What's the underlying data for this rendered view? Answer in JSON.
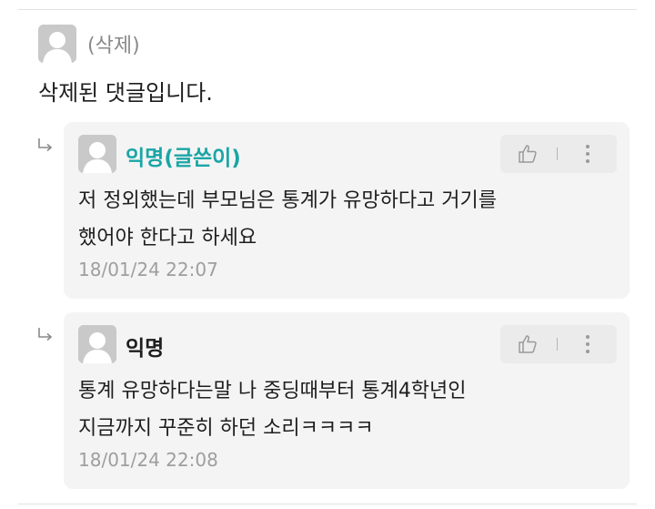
{
  "root_comment": {
    "author": "(삭제)",
    "body": "삭제된 댓글입니다."
  },
  "replies": [
    {
      "author": "익명(글쓴이)",
      "lines": [
        "저 정외했는데 부모님은 통계가 유망하다고 거기를",
        "했어야 한다고 하세요"
      ],
      "time": "18/01/24 22:07",
      "author_color": "#1aa5a6"
    },
    {
      "author": "익명",
      "lines": [
        "통계 유망하다는말 나 중딩때부터 통계4학년인",
        "지금까지 꾸준히 하던 소리ㅋㅋㅋㅋ"
      ],
      "time": "18/01/24 22:08",
      "author_color": "#1e1e1e"
    }
  ],
  "icons": {
    "reply": "reply-arrow-icon",
    "like": "thumbs-up-icon",
    "more": "more-vertical-icon",
    "avatar": "default-avatar-icon"
  }
}
